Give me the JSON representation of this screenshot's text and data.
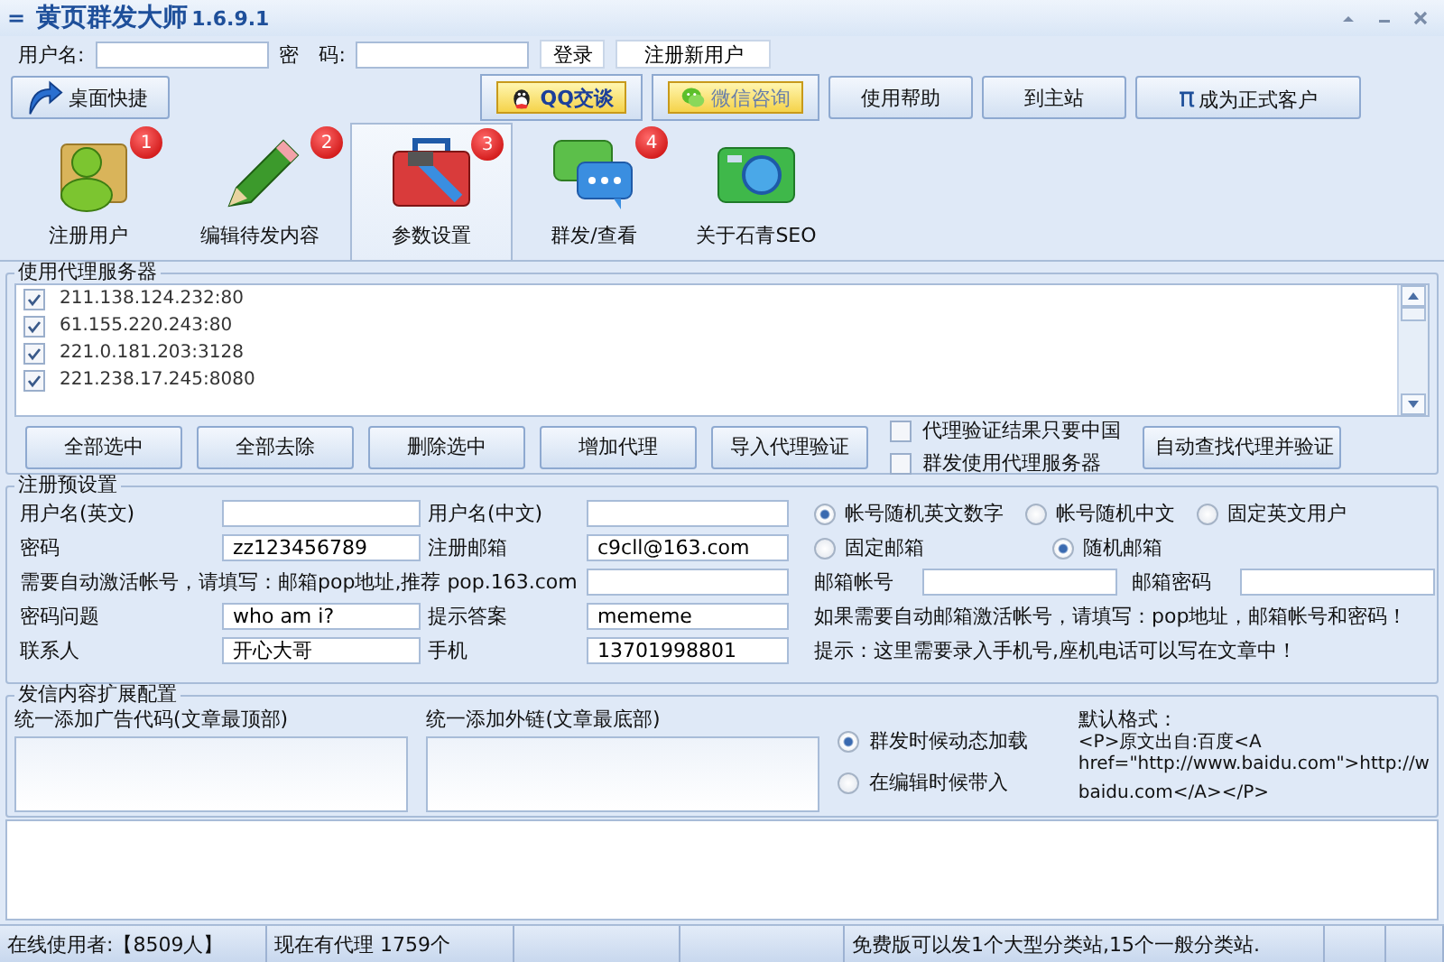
{
  "window": {
    "title": "黄页群发大师",
    "version": "1.6.9.1",
    "menu_glyph": "="
  },
  "login": {
    "username_label": "用户名:",
    "password_label": "密　码:",
    "login_button": "登录",
    "register_button": "注册新用户"
  },
  "toolbar": {
    "desktop_button": "桌面快捷",
    "qq_button": "QQ交谈",
    "wechat_button": "微信咨询",
    "help_button": "使用帮助",
    "site_button": "到主站",
    "pi_symbol": "π",
    "upgrade_button": "成为正式客户"
  },
  "tabs": [
    {
      "label": "注册用户",
      "badge": "1",
      "selected": false
    },
    {
      "label": "编辑待发内容",
      "badge": "2",
      "selected": false
    },
    {
      "label": "参数设置",
      "badge": "3",
      "selected": true
    },
    {
      "label": "群发/查看",
      "badge": "4",
      "selected": false
    },
    {
      "label": "关于石青SEO",
      "selected": false
    }
  ],
  "proxy": {
    "title": "使用代理服务器",
    "servers": [
      {
        "address": "211.138.124.232:80",
        "checked": true
      },
      {
        "address": "61.155.220.243:80",
        "checked": true
      },
      {
        "address": "221.0.181.203:3128",
        "checked": true
      },
      {
        "address": "221.238.17.245:8080",
        "checked": true
      }
    ],
    "buttons": [
      "全部选中",
      "全部去除",
      "删除选中",
      "增加代理",
      "导入代理验证"
    ],
    "options": [
      {
        "label": "代理验证结果只要中国",
        "checked": false
      },
      {
        "label": "群发使用代理服务器",
        "checked": false
      }
    ],
    "auto_button": "自动查找代理并验证"
  },
  "registration": {
    "title": "注册预设置",
    "username_en_label": "用户名(英文)",
    "username_cn_label": "用户名(中文)",
    "password_label": "密码",
    "password": "zz123456789",
    "email_label": "注册邮箱",
    "email": "c9cll@163.com",
    "pop_label": "需要自动激活帐号，请填写：邮箱pop地址,推荐 pop.163.com",
    "question_label": "密码问题",
    "question": "who am i?",
    "answer_label": "提示答案",
    "answer": "mememe",
    "contact_label": "联系人",
    "contact": "开心大哥",
    "phone_label": "手机",
    "phone": "13701998801",
    "account_modes": [
      {
        "label": "帐号随机英文数字",
        "selected": true
      },
      {
        "label": "帐号随机中文",
        "selected": false
      },
      {
        "label": "固定英文用户",
        "selected": false
      }
    ],
    "email_modes": [
      {
        "label": "固定邮箱",
        "selected": false
      },
      {
        "label": "随机邮箱",
        "selected": true
      }
    ],
    "mail_account_label": "邮箱帐号",
    "mail_password_label": "邮箱密码",
    "activation_hint": "如果需要自动邮箱激活帐号，请填写：pop地址，邮箱帐号和密码！",
    "phone_hint": "提示：这里需要录入手机号,座机电话可以写在文章中！"
  },
  "content": {
    "title": "发信内容扩展配置",
    "top_label": "统一添加广告代码(文章最顶部)",
    "bottom_label": "统一添加外链(文章最底部)",
    "load_modes": [
      {
        "label": "群发时候动态加载",
        "selected": true
      },
      {
        "label": "在编辑时候带入",
        "selected": false
      }
    ],
    "format_title": "默认格式：",
    "format_lines": [
      "<P>原文出自:百度<A",
      "href=\"http://www.baidu.com\">http://w",
      "baidu.com</A></P>"
    ]
  },
  "status_bar": {
    "online": "在线使用者:【8509人】",
    "proxies": "现在有代理 1759个",
    "notice": "免费版可以发1个大型分类站,15个一般分类站."
  }
}
